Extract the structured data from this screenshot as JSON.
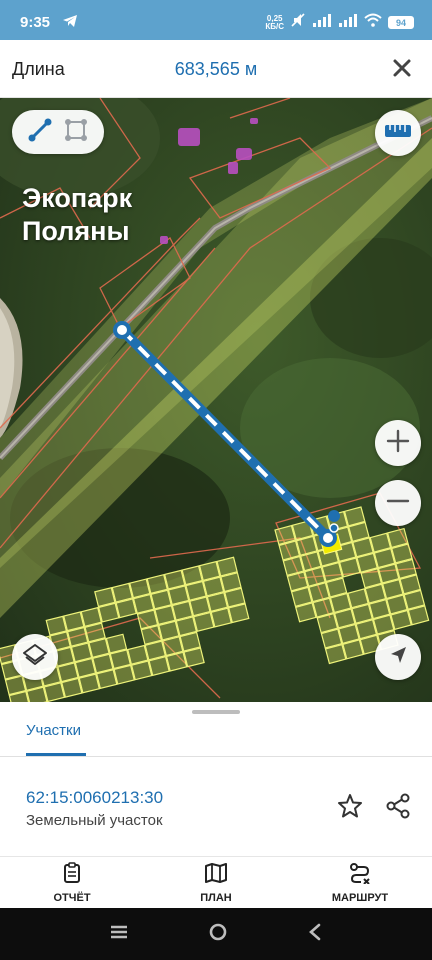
{
  "status_bar": {
    "time": "9:35",
    "speed_value": "0,25",
    "speed_unit": "КБ/С",
    "battery": "94"
  },
  "header": {
    "title": "Длина",
    "value": "683,565 м"
  },
  "map": {
    "place_label": "Экопарк Поляны"
  },
  "sheet": {
    "tab_label": "Участки",
    "parcel_id": "62:15:0060213:30",
    "parcel_type": "Земельный участок"
  },
  "bottom_nav": {
    "report_label": "ОТЧЁТ",
    "plan_label": "ПЛАН",
    "route_label": "МАРШРУТ"
  },
  "colors": {
    "accent": "#1f6fb0",
    "status_bar": "#5da2cd",
    "parcel_fill": "#e7f06a",
    "parcel_border": "#e06a4e"
  }
}
